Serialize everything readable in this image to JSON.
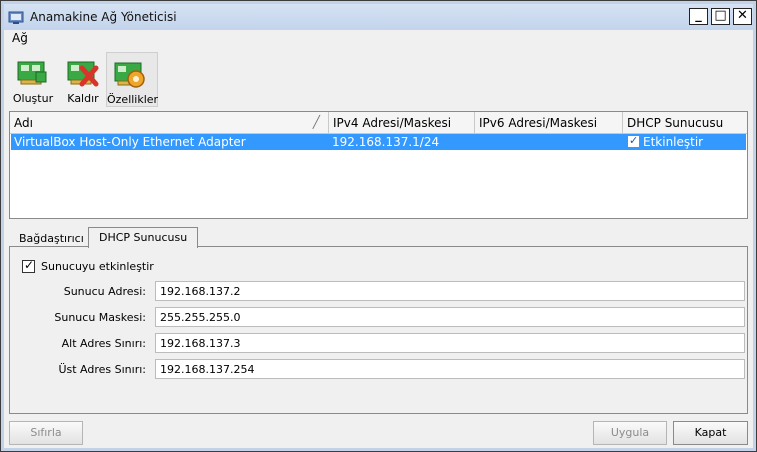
{
  "window": {
    "title": "Anamakine Ağ Yöneticisi",
    "icon": "network-manager-icon"
  },
  "window_controls": {
    "minimize": "_",
    "maximize": "□",
    "close": "✕"
  },
  "menu": {
    "items": [
      {
        "label": "Ağ"
      }
    ]
  },
  "toolbar": {
    "items": [
      {
        "label": "Oluştur",
        "icon": "network-card-add-icon"
      },
      {
        "label": "Kaldır",
        "icon": "network-card-remove-icon"
      },
      {
        "label": "Özellikler",
        "icon": "network-card-properties-icon"
      }
    ]
  },
  "table": {
    "columns": [
      "Adı",
      "IPv4 Adresi/Maskesi",
      "IPv6 Adresi/Maskesi",
      "DHCP Sunucusu"
    ],
    "rows": [
      {
        "name": "VirtualBox Host-Only Ethernet Adapter",
        "ipv4": "192.168.137.1/24",
        "ipv6": "",
        "dhcp": "Etkinleştir",
        "dhcp_checked": true,
        "selected": true
      }
    ]
  },
  "tabs": [
    {
      "label": "Bağdaştırıcı"
    },
    {
      "label": "DHCP Sunucusu",
      "active": true
    }
  ],
  "dhcp": {
    "enable_label": "Sunucuyu etkinleştir",
    "enabled": true,
    "fields": [
      {
        "label": "Sunucu Adresi:",
        "value": "192.168.137.2"
      },
      {
        "label": "Sunucu Maskesi:",
        "value": "255.255.255.0"
      },
      {
        "label": "Alt Adres Sınırı:",
        "value": "192.168.137.3"
      },
      {
        "label": "Üst Adres Sınırı:",
        "value": "192.168.137.254"
      }
    ]
  },
  "buttons": {
    "reset": "Sıfırla",
    "apply": "Uygula",
    "close": "Kapat"
  },
  "colors": {
    "selection": "#3399ff",
    "titlebar": "#c9d9ef"
  }
}
